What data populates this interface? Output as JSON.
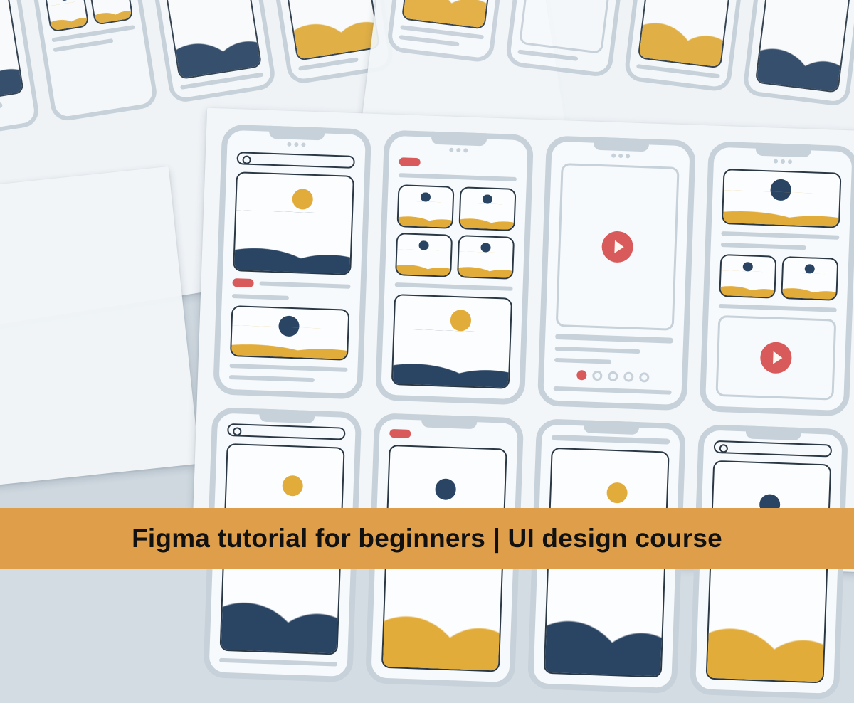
{
  "caption": {
    "title": "Figma tutorial for beginners | UI design course"
  },
  "palette": {
    "banner_bg": "#df9f4a",
    "outline_grey": "#c7d1d9",
    "navy": "#2a4463",
    "gold": "#e2ac3a",
    "coral": "#d85a5a",
    "paper": "#f2f6f8"
  },
  "icons": {
    "play": "play-icon",
    "search": "search-icon",
    "image_placeholder": "image-placeholder-icon"
  }
}
